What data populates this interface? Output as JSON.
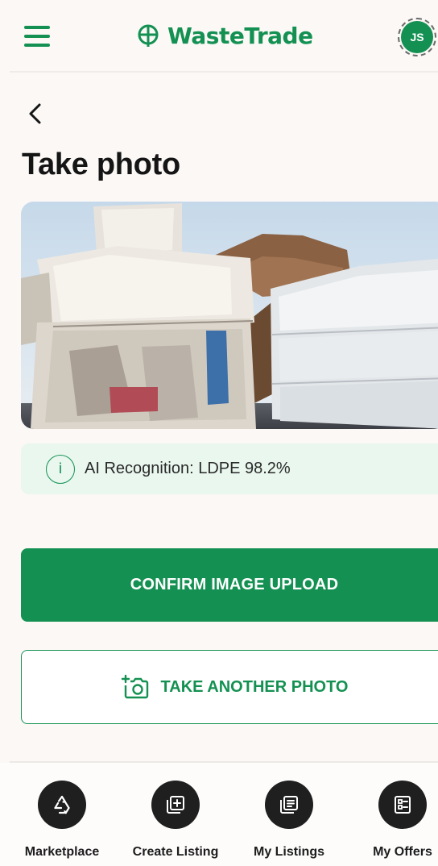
{
  "header": {
    "brand": "WasteTrade",
    "avatar_initials": "JS",
    "accent": "#149152"
  },
  "page": {
    "title": "Take photo"
  },
  "recognition": {
    "icon": "info-icon",
    "icon_glyph": "i",
    "text": "AI Recognition: LDPE 98.2%"
  },
  "actions": {
    "confirm_label": "CONFIRM IMAGE UPLOAD",
    "another_label": "TAKE ANOTHER PHOTO",
    "another_icon": "add-photo-icon"
  },
  "bottom_nav": {
    "items": [
      {
        "label": "Marketplace",
        "icon": "recycle-icon"
      },
      {
        "label": "Create Listing",
        "icon": "add-box-icon"
      },
      {
        "label": "My Listings",
        "icon": "listings-icon"
      },
      {
        "label": "My Offers",
        "icon": "offers-icon"
      }
    ]
  }
}
